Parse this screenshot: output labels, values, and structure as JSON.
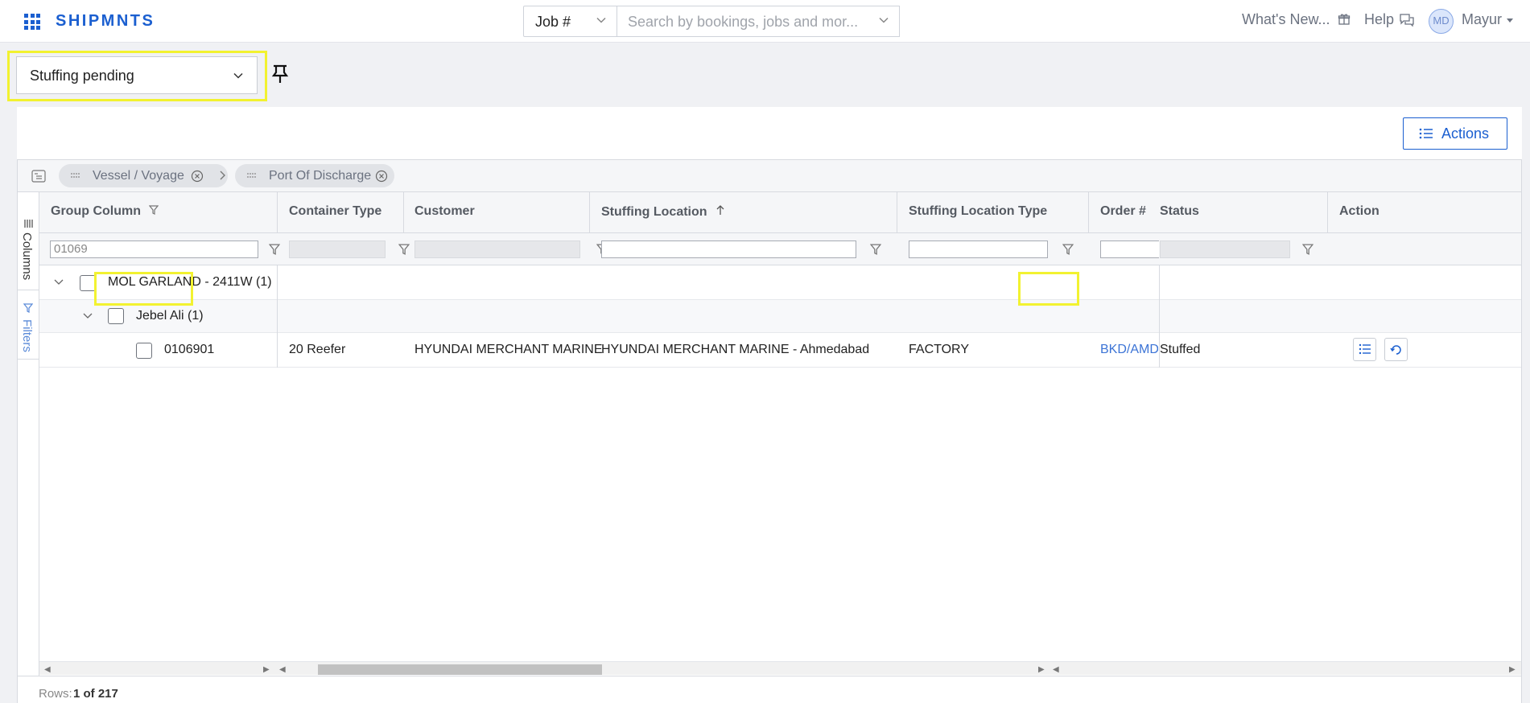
{
  "app": {
    "brand": "SHIPMNTS"
  },
  "topbar": {
    "job_select": "Job #",
    "search_placeholder": "Search by bookings, jobs and mor...",
    "whats_new": "What's New...",
    "help": "Help",
    "avatar_initials": "MD",
    "user_name": "Mayur"
  },
  "view": {
    "selected": "Stuffing pending"
  },
  "toolbar": {
    "actions_label": "Actions"
  },
  "grouping": {
    "chips": [
      "Vessel / Voyage",
      "Port Of Discharge"
    ]
  },
  "sidebar": {
    "columns": "Columns",
    "filters": "Filters"
  },
  "columns": {
    "group": "Group Column",
    "container_type": "Container Type",
    "customer": "Customer",
    "stuffing_location": "Stuffing Location",
    "stuffing_location_type": "Stuffing Location Type",
    "order": "Order #",
    "status": "Status",
    "action": "Action"
  },
  "filters": {
    "group_value": "01069"
  },
  "rows": {
    "group1": {
      "label": "MOL GARLAND - 2411W (1)"
    },
    "group2": {
      "label": "Jebel Ali (1)"
    },
    "data": {
      "id": "0106901",
      "container_type": "20 Reefer",
      "customer": "HYUNDAI MERCHANT MARINE",
      "stuffing_location": "HYUNDAI MERCHANT MARINE - Ahmedabad",
      "stuffing_location_type": "FACTORY",
      "order": "BKD/AMD/",
      "status": "Stuffed"
    }
  },
  "footer": {
    "rows_label": "Rows:",
    "rows_value": "1 of 217"
  },
  "colors": {
    "accent": "#1b5fd0",
    "highlight": "#f2f230"
  }
}
